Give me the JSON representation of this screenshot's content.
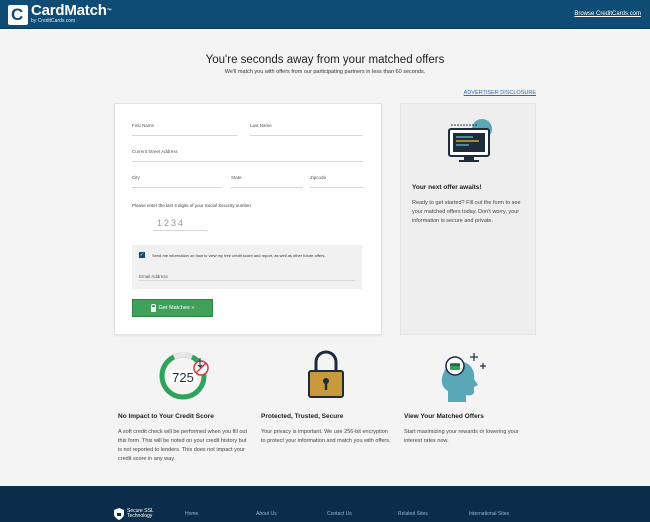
{
  "header": {
    "logo_title": "CardMatch",
    "logo_tm": "™",
    "logo_sub": "by CreditCards.com",
    "logo_letter": "C",
    "link": "Browse CreditCards.com"
  },
  "hero": {
    "title": "You're seconds away from your matched offers",
    "subtitle": "We'll match you with offers from our participating partners in less than 60 seconds."
  },
  "advertiser_disclosure": "ADVERTISER DISCLOSURE",
  "form": {
    "first_name": "First Name",
    "last_name": "Last Name",
    "street": "Current Street Address",
    "city": "City",
    "state": "State",
    "zip": "Zipcode",
    "ssn_label": "Please enter the last 4 digits of your Social Security number",
    "ssn_placeholder": "1234",
    "consent_checked": true,
    "consent_text": "Send me information on how to view my free credit score and report, as well as other future offers.",
    "email_label": "Email Address",
    "cta_label": "Get Matches »"
  },
  "side": {
    "title": "Your next offer awaits!",
    "text": "Ready to get started? Fill out the form to see your matched offers today. Don't worry, your information is secure and private."
  },
  "features": [
    {
      "title": "No Impact to Your Credit Score",
      "text": "A soft credit check will be performed when you fill out this form. This will be noted on your credit history but is not reported to lenders. This does not impact your credit score in any way.",
      "icon": "credit-score-icon",
      "score": "725"
    },
    {
      "title": "Protected, Trusted, Secure",
      "text": "Your privacy is important. We use 256-bit encryption to protect your information and match you with offers.",
      "icon": "padlock-icon"
    },
    {
      "title": "View Your Matched Offers",
      "text": "Start maximizing your rewards or lowering your interest rates now.",
      "icon": "head-card-icon"
    }
  ],
  "footer": {
    "ssl_line1": "Secure SSL",
    "ssl_line2": "Technology",
    "links": [
      "Home",
      "About Us",
      "Contact Us",
      "Related Sites",
      "International Sites"
    ]
  },
  "colors": {
    "header": "#0f4c75",
    "cta": "#3fa05a",
    "footer": "#0b2d4b",
    "accent_teal": "#5aa7b8",
    "lock_gold": "#c99a3c"
  }
}
